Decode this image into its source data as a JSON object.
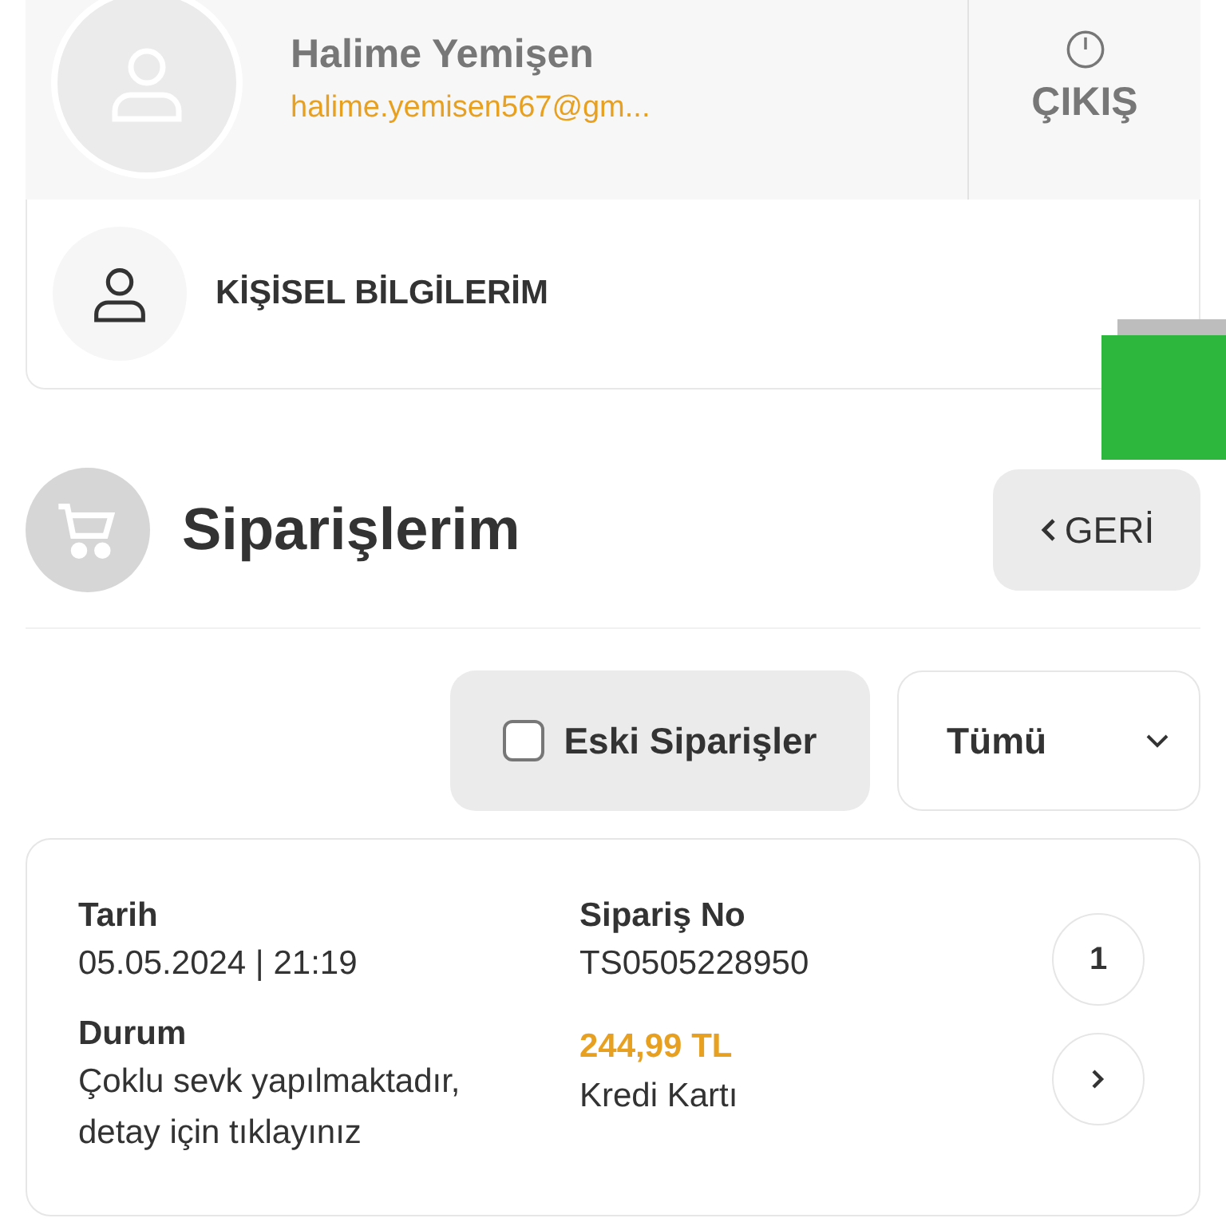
{
  "user": {
    "name": "Halime Yemişen",
    "email": "halime.yemisen567@gm..."
  },
  "logout": {
    "label": "ÇIKIŞ"
  },
  "menu": [
    {
      "label": "KİŞİSEL BİLGİLERİM"
    }
  ],
  "page": {
    "title": "Siparişlerim",
    "back": "GERİ"
  },
  "filters": {
    "old_orders": {
      "label": "Eski Siparişler",
      "checked": false
    },
    "status_select": {
      "value": "Tümü"
    }
  },
  "orders": [
    {
      "date_label": "Tarih",
      "date": "05.05.2024 | 21:19",
      "order_no_label": "Sipariş No",
      "order_no": "TS0505228950",
      "status_label": "Durum",
      "status": "Çoklu sevk yapılmaktadır, detay için tıklayınız",
      "amount": "244,99 TL",
      "payment": "Kredi Kartı",
      "count": "1"
    }
  ]
}
